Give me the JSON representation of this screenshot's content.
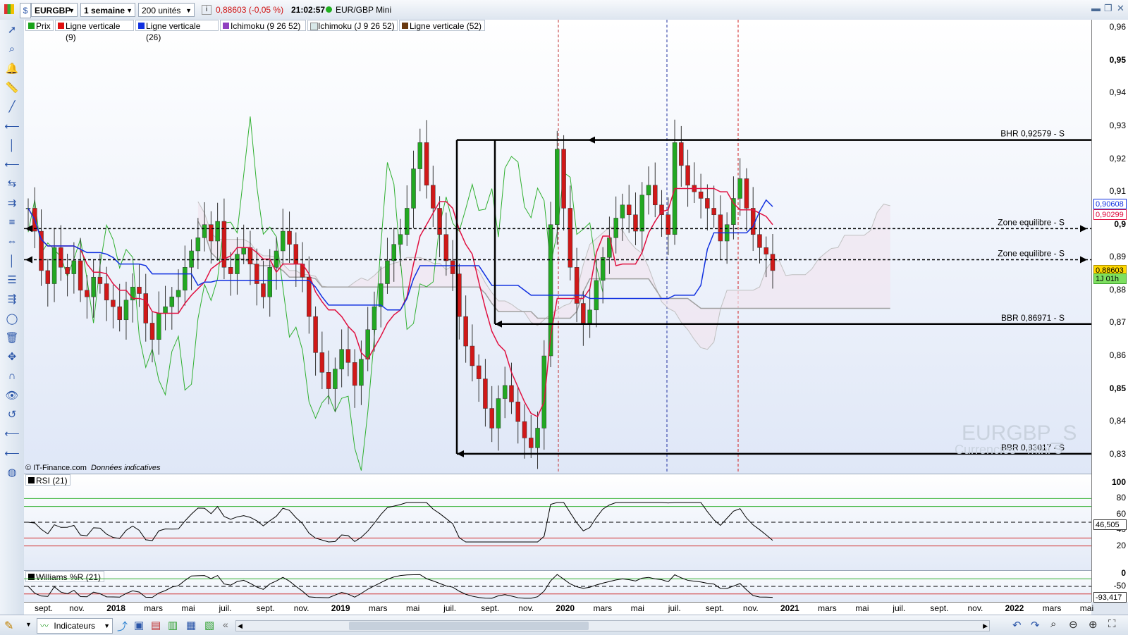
{
  "toolbar": {
    "symbol": "EURGBP",
    "period": "1 semaine",
    "units": "200 unités",
    "price_change": "0,88603 (-0,05 %)",
    "time": "21:02:57",
    "instrument": "EUR/GBP Mini"
  },
  "legend": [
    {
      "label": "Prix",
      "color": "#1aa31a"
    },
    {
      "label": "Ligne verticale (9)",
      "color": "#e01010"
    },
    {
      "label": "Ligne verticale (26)",
      "color": "#1030e0"
    },
    {
      "label": "Ichimoku (9 26 52)",
      "color": "#9040c0"
    },
    {
      "label": "Ichimoku (J 9 26 52)",
      "color": "#d8e8e8"
    },
    {
      "label": "Ligne verticale (52)",
      "color": "#6b3a10"
    }
  ],
  "y_axis": {
    "labels": [
      "0,96",
      "0,95",
      "0,94",
      "0,93",
      "0,92",
      "0,91",
      "0,9",
      "0,89",
      "0,88",
      "0,87",
      "0,86",
      "0,85",
      "0,84",
      "0,83"
    ],
    "bold_labels": [
      "0,95",
      "0,9",
      "0,85"
    ],
    "tags": [
      {
        "text": "0,90608",
        "bg": "#ffffff",
        "border": "#1030e0",
        "color": "#1030e0",
        "value": 0.90608
      },
      {
        "text": "0,90299",
        "bg": "#ffffff",
        "border": "#e01040",
        "color": "#e01040",
        "value": 0.90299
      },
      {
        "text": "0,88603",
        "bg": "#ffd800",
        "border": "#b09000",
        "color": "#000000",
        "value": 0.88603
      },
      {
        "text": "1J 01h",
        "bg": "#7ee060",
        "border": "#40a030",
        "color": "#000000",
        "value": 0.8835
      }
    ]
  },
  "annotations": [
    {
      "text": "BHR 0,92579 - S",
      "value": 0.92579
    },
    {
      "text": "Zone equilibre - S",
      "value": 0.8988
    },
    {
      "text": "Zone equilibre - S",
      "value": 0.8893
    },
    {
      "text": "BBR 0,86971 - S",
      "value": 0.86971
    },
    {
      "text": "BBR 0,83017 - S",
      "value": 0.83017
    }
  ],
  "watermark": {
    "title": "EURGBP_S",
    "subtitle": "Currencies - Mini S"
  },
  "source_note": {
    "brand": "© IT-Finance.com",
    "note": "Données indicatives"
  },
  "rsi": {
    "label": "RSI (21)",
    "levels": [
      "100",
      "80",
      "60",
      "40",
      "20"
    ],
    "current": "46,505"
  },
  "williams": {
    "label": "Williams %R (21)",
    "levels": [
      "0",
      "-50"
    ],
    "current": "-93,417"
  },
  "x_axis": [
    {
      "label": "sept.",
      "bold": false
    },
    {
      "label": "nov.",
      "bold": false
    },
    {
      "label": "2018",
      "bold": true
    },
    {
      "label": "mars",
      "bold": false
    },
    {
      "label": "mai",
      "bold": false
    },
    {
      "label": "juil.",
      "bold": false
    },
    {
      "label": "sept.",
      "bold": false
    },
    {
      "label": "nov.",
      "bold": false
    },
    {
      "label": "2019",
      "bold": true
    },
    {
      "label": "mars",
      "bold": false
    },
    {
      "label": "mai",
      "bold": false
    },
    {
      "label": "juil.",
      "bold": false
    },
    {
      "label": "sept.",
      "bold": false
    },
    {
      "label": "nov.",
      "bold": false
    },
    {
      "label": "2020",
      "bold": true
    },
    {
      "label": "mars",
      "bold": false
    },
    {
      "label": "mai",
      "bold": false
    },
    {
      "label": "juil.",
      "bold": false
    },
    {
      "label": "sept.",
      "bold": false
    },
    {
      "label": "nov.",
      "bold": false
    },
    {
      "label": "2021",
      "bold": true
    },
    {
      "label": "mars",
      "bold": false
    },
    {
      "label": "mai",
      "bold": false
    },
    {
      "label": "juil.",
      "bold": false
    },
    {
      "label": "sept.",
      "bold": false
    },
    {
      "label": "nov.",
      "bold": false
    },
    {
      "label": "2022",
      "bold": true
    },
    {
      "label": "mars",
      "bold": false
    },
    {
      "label": "mai",
      "bold": false
    }
  ],
  "bottombar": {
    "indicators_label": "Indicateurs"
  },
  "icons": {
    "left_tools": [
      "cursor-icon",
      "zoom-icon",
      "alert-bell-icon",
      "ruler-icon",
      "trendline-icon",
      "horizontal-line-icon",
      "vertical-line-icon",
      "left-line-icon",
      "channel-icon",
      "parallel-icon",
      "fibonacci-icon",
      "arrows-icon",
      "text-icon",
      "list-icon",
      "pattern-icon",
      "ellipse-icon",
      "trash-icon",
      "move-icon",
      "magnet-icon",
      "eye-icon",
      "undo-icon",
      "line-tool-icon",
      "line-tool2-icon",
      "color-wheel-icon"
    ]
  },
  "chart_data": {
    "type": "candlestick",
    "title": "EURGBP",
    "ylim": [
      0.825,
      0.962
    ],
    "x_start": "2017-08-28",
    "x_end": "2022-05-30",
    "price_weekly_close_approx": [
      0.905,
      0.898,
      0.886,
      0.882,
      0.893,
      0.887,
      0.885,
      0.889,
      0.88,
      0.878,
      0.884,
      0.882,
      0.877,
      0.875,
      0.871,
      0.877,
      0.881,
      0.879,
      0.87,
      0.865,
      0.873,
      0.875,
      0.878,
      0.88,
      0.887,
      0.892,
      0.896,
      0.9,
      0.895,
      0.901,
      0.887,
      0.885,
      0.891,
      0.893,
      0.888,
      0.882,
      0.878,
      0.887,
      0.892,
      0.898,
      0.894,
      0.888,
      0.884,
      0.872,
      0.861,
      0.855,
      0.85,
      0.856,
      0.862,
      0.858,
      0.851,
      0.859,
      0.868,
      0.875,
      0.882,
      0.889,
      0.894,
      0.897,
      0.905,
      0.917,
      0.925,
      0.912,
      0.905,
      0.897,
      0.889,
      0.885,
      0.872,
      0.863,
      0.857,
      0.853,
      0.844,
      0.838,
      0.847,
      0.851,
      0.846,
      0.84,
      0.835,
      0.832,
      0.838,
      0.86,
      0.9,
      0.923,
      0.905,
      0.887,
      0.876,
      0.87,
      0.874,
      0.883,
      0.89,
      0.896,
      0.902,
      0.906,
      0.903,
      0.898,
      0.909,
      0.912,
      0.906,
      0.903,
      0.897,
      0.925,
      0.918,
      0.912,
      0.91,
      0.908,
      0.905,
      0.903,
      0.895,
      0.9,
      0.908,
      0.914,
      0.905,
      0.897,
      0.893,
      0.891,
      0.886
    ],
    "ichimoku_tenkan_color": "#e01040",
    "ichimoku_kijun_color": "#1030e0",
    "chikou_color": "#30b030",
    "support_resistance": [
      {
        "label": "BHR",
        "value": 0.92579
      },
      {
        "label": "BBR",
        "value": 0.86971
      },
      {
        "label": "BBR",
        "value": 0.83017
      }
    ]
  }
}
